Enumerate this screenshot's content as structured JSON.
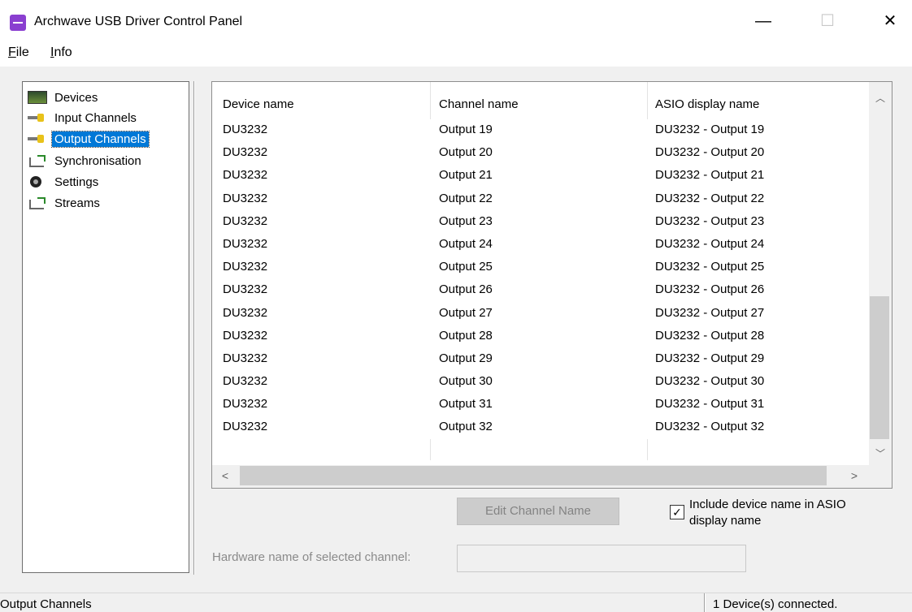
{
  "window": {
    "title": "Archwave USB Driver Control Panel",
    "minimize": "—",
    "maximize": "☐",
    "close": "✕"
  },
  "menu": {
    "file": "File",
    "info": "Info"
  },
  "nav": {
    "items": [
      {
        "label": "Devices",
        "icon": "devices-icon"
      },
      {
        "label": "Input Channels",
        "icon": "input-channels-icon"
      },
      {
        "label": "Output Channels",
        "icon": "output-channels-icon",
        "selected": true
      },
      {
        "label": "Synchronisation",
        "icon": "synchronisation-icon"
      },
      {
        "label": "Settings",
        "icon": "settings-icon"
      },
      {
        "label": "Streams",
        "icon": "streams-icon"
      }
    ]
  },
  "table": {
    "headers": [
      "Device name",
      "Channel name",
      "ASIO display name"
    ],
    "rows": [
      [
        "DU3232",
        "Output 19",
        "DU3232 - Output 19"
      ],
      [
        "DU3232",
        "Output 20",
        "DU3232 - Output 20"
      ],
      [
        "DU3232",
        "Output 21",
        "DU3232 - Output 21"
      ],
      [
        "DU3232",
        "Output 22",
        "DU3232 - Output 22"
      ],
      [
        "DU3232",
        "Output 23",
        "DU3232 - Output 23"
      ],
      [
        "DU3232",
        "Output 24",
        "DU3232 - Output 24"
      ],
      [
        "DU3232",
        "Output 25",
        "DU3232 - Output 25"
      ],
      [
        "DU3232",
        "Output 26",
        "DU3232 - Output 26"
      ],
      [
        "DU3232",
        "Output 27",
        "DU3232 - Output 27"
      ],
      [
        "DU3232",
        "Output 28",
        "DU3232 - Output 28"
      ],
      [
        "DU3232",
        "Output 29",
        "DU3232 - Output 29"
      ],
      [
        "DU3232",
        "Output 30",
        "DU3232 - Output 30"
      ],
      [
        "DU3232",
        "Output 31",
        "DU3232 - Output 31"
      ],
      [
        "DU3232",
        "Output 32",
        "DU3232 - Output 32"
      ]
    ]
  },
  "buttons": {
    "edit_channel_name": "Edit Channel Name"
  },
  "checkbox": {
    "label": "Include device name in ASIO display name",
    "checked": true
  },
  "hardware": {
    "label": "Hardware name of selected channel:",
    "value": ""
  },
  "status": {
    "left": "Output Channels",
    "right": "1 Device(s) connected."
  },
  "colors": {
    "selection": "#0078d7",
    "app_icon": "#8a3fd0"
  }
}
